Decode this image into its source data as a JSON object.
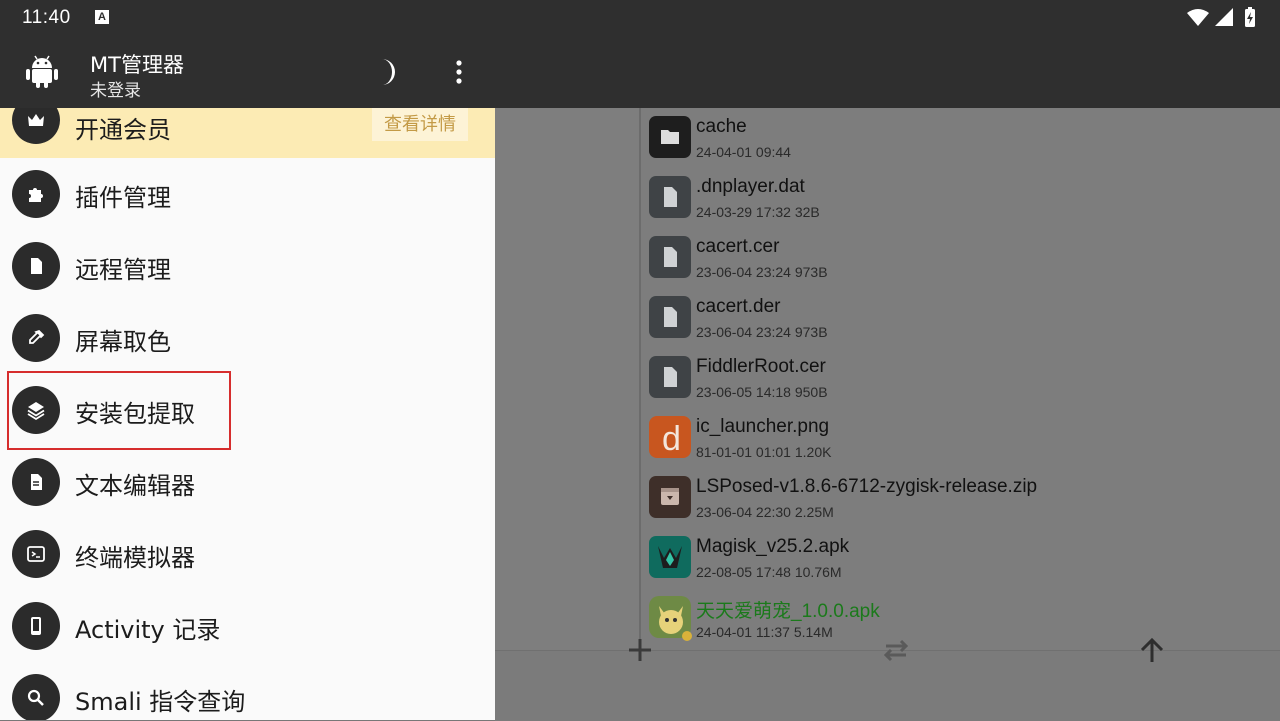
{
  "status_bar": {
    "time": "11:40",
    "notif_icon": "A"
  },
  "drawer": {
    "app_title": "MT管理器",
    "subtitle": "未登录",
    "vip": {
      "label": "开通会员",
      "detail": "查看详情"
    },
    "items": [
      {
        "label": "插件管理",
        "icon": "puzzle-icon"
      },
      {
        "label": "远程管理",
        "icon": "file-icon"
      },
      {
        "label": "屏幕取色",
        "icon": "color-picker-icon"
      },
      {
        "label": "安装包提取",
        "icon": "layers-icon"
      },
      {
        "label": "文本编辑器",
        "icon": "document-icon"
      },
      {
        "label": "终端模拟器",
        "icon": "terminal-icon"
      },
      {
        "label": "Activity 记录",
        "icon": "phone-icon"
      },
      {
        "label": "Smali 指令查询",
        "icon": "search-icon"
      }
    ]
  },
  "files": [
    {
      "name": "cache",
      "meta": "24-04-01 09:44",
      "icon": "folder-icon"
    },
    {
      "name": ".dnplayer.dat",
      "meta": "24-03-29 17:32  32B",
      "icon": "file-icon"
    },
    {
      "name": "cacert.cer",
      "meta": "23-06-04 23:24  973B",
      "icon": "file-icon"
    },
    {
      "name": "cacert.der",
      "meta": "23-06-04 23:24  973B",
      "icon": "file-icon"
    },
    {
      "name": "FiddlerRoot.cer",
      "meta": "23-06-05 14:18  950B",
      "icon": "file-icon"
    },
    {
      "name": "ic_launcher.png",
      "meta": "81-01-01 01:01  1.20K",
      "icon": "image-thumbnail"
    },
    {
      "name": "LSPosed-v1.8.6-6712-zygisk-release.zip",
      "meta": "23-06-04 22:30  2.25M",
      "icon": "archive-icon"
    },
    {
      "name": "Magisk_v25.2.apk",
      "meta": "22-08-05 17:48  10.76M",
      "icon": "magisk-app-icon"
    },
    {
      "name": "天天爱萌宠_1.0.0.apk",
      "meta": "24-04-01 11:37  5.14M",
      "icon": "pet-app-icon"
    }
  ],
  "colors": {
    "vip_bg": "#fcebb4",
    "highlight": "#d62d2d",
    "installed_apk": "#1b7a1b"
  }
}
